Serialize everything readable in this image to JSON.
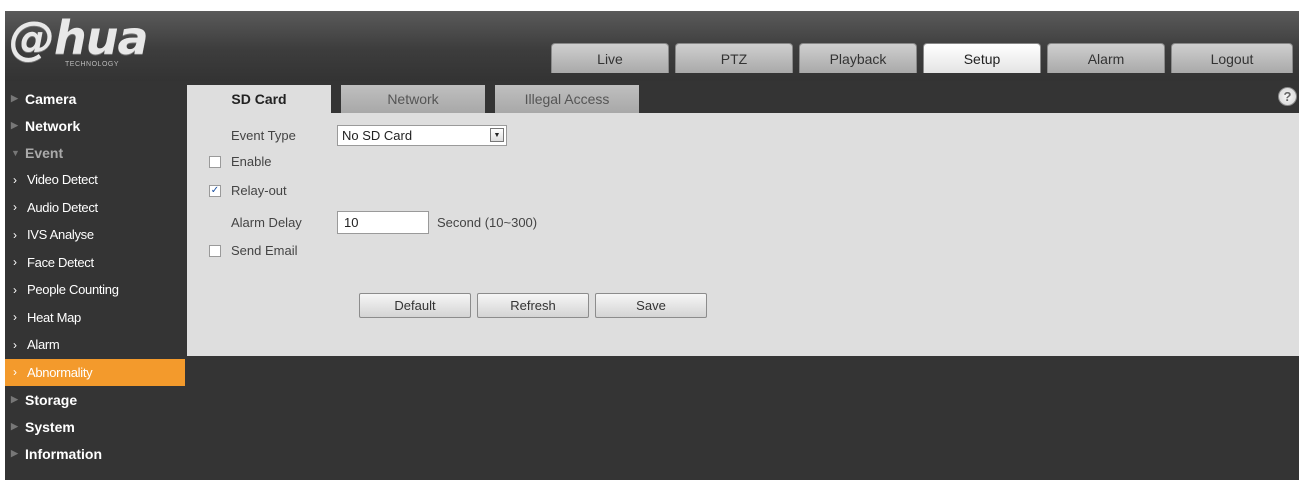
{
  "logo": {
    "main": "@hua",
    "sub": "TECHNOLOGY"
  },
  "top_tabs": [
    {
      "label": "Live",
      "active": false
    },
    {
      "label": "PTZ",
      "active": false
    },
    {
      "label": "Playback",
      "active": false
    },
    {
      "label": "Setup",
      "active": true
    },
    {
      "label": "Alarm",
      "active": false
    },
    {
      "label": "Logout",
      "active": false
    }
  ],
  "sidebar": {
    "camera": "Camera",
    "network": "Network",
    "event": "Event",
    "event_items": [
      "Video Detect",
      "Audio Detect",
      "IVS Analyse",
      "Face Detect",
      "People Counting",
      "Heat Map",
      "Alarm",
      "Abnormality"
    ],
    "active_item": "Abnormality",
    "storage": "Storage",
    "system": "System",
    "information": "Information"
  },
  "content_tabs": [
    "SD Card",
    "Network",
    "Illegal Access"
  ],
  "help_glyph": "?",
  "form": {
    "event_type_label": "Event Type",
    "event_type_value": "No SD Card",
    "enable_label": "Enable",
    "enable_checked": false,
    "relay_out_label": "Relay-out",
    "relay_out_checked": true,
    "alarm_delay_label": "Alarm Delay",
    "alarm_delay_value": "10",
    "alarm_delay_unit": "Second (10~300)",
    "send_email_label": "Send Email",
    "send_email_checked": false
  },
  "buttons": {
    "default": "Default",
    "refresh": "Refresh",
    "save": "Save"
  },
  "colors": {
    "active_menu": "#f39a2c",
    "panel": "#dedede",
    "background": "#343434"
  }
}
